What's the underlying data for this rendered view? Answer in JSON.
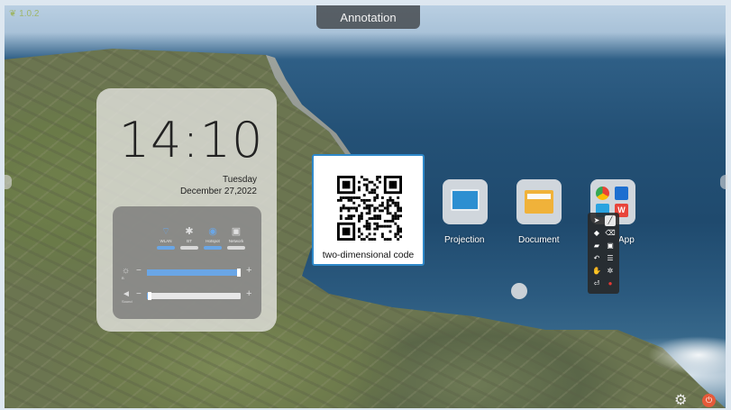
{
  "status_bar": {
    "logo_text": "1.0.2"
  },
  "annotation_tab": {
    "label": "Annotation"
  },
  "clock": {
    "time": "14:10",
    "day": "Tuesday",
    "date": "December 27,2022"
  },
  "quick_settings": {
    "toggles": [
      {
        "icon": "wifi-icon",
        "glyph": "⌔",
        "label": "WLAN",
        "on": true
      },
      {
        "icon": "bluetooth-icon",
        "glyph": "✱",
        "label": "BT",
        "on": false
      },
      {
        "icon": "hotspot-icon",
        "glyph": "◉",
        "label": "Hotspot",
        "on": true
      },
      {
        "icon": "network-icon",
        "glyph": "▣",
        "label": "Network",
        "on": false
      }
    ],
    "brightness": {
      "icon": "brightness-icon",
      "glyph": "☼",
      "value": 1.0,
      "sublabel": "B"
    },
    "volume": {
      "icon": "volume-icon",
      "glyph": "◄",
      "value": 0.03,
      "sublabel": "Sound"
    }
  },
  "qr_card": {
    "label": "two-dimensional code"
  },
  "apps": [
    {
      "name": "Projection",
      "icon": "projection-icon"
    },
    {
      "name": "Document",
      "icon": "document-icon"
    },
    {
      "name": "App",
      "icon": "app-folder-icon"
    }
  ],
  "annotation_toolbar": {
    "tools": [
      {
        "icon": "pointer-icon",
        "glyph": "➤"
      },
      {
        "icon": "pen-icon",
        "glyph": "╱",
        "active": true
      },
      {
        "icon": "eraser-icon",
        "glyph": "◆"
      },
      {
        "icon": "clear-icon",
        "glyph": "⌫"
      },
      {
        "icon": "open-folder-icon",
        "glyph": "▰"
      },
      {
        "icon": "save-icon",
        "glyph": "▣"
      },
      {
        "icon": "undo-icon",
        "glyph": "↶"
      },
      {
        "icon": "menu-icon",
        "glyph": "☰"
      },
      {
        "icon": "hand-icon",
        "glyph": "✋"
      },
      {
        "icon": "settings-icon",
        "glyph": "✲"
      },
      {
        "icon": "exit-icon",
        "glyph": "⏎"
      },
      {
        "icon": "record-icon",
        "glyph": "●"
      }
    ]
  },
  "colors": {
    "accent": "#2e88c9",
    "toggle_on": "#6aa6e6",
    "power": "#e55a3a"
  }
}
